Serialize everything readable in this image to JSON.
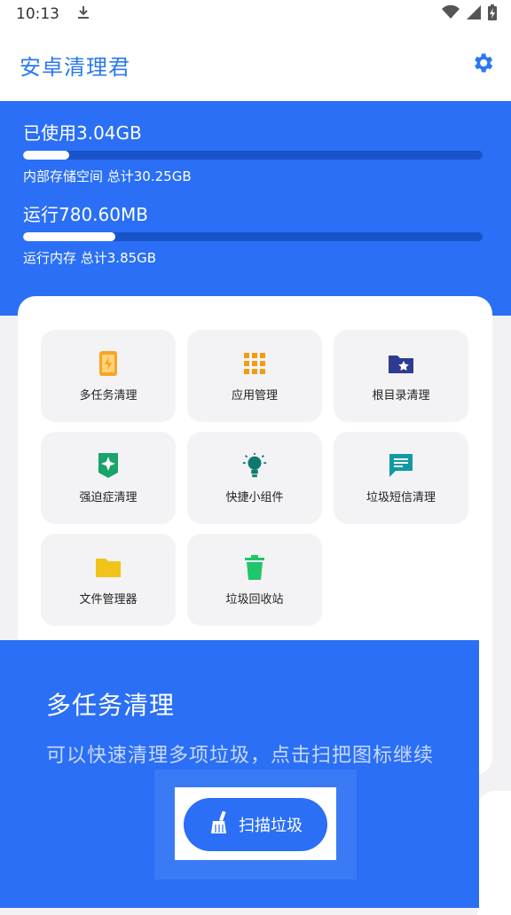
{
  "status_bar": {
    "time": "10:13",
    "download_icon": "download-icon",
    "wifi_icon": "wifi-icon",
    "signal_icon": "signal-icon",
    "battery_icon": "battery-charging-icon"
  },
  "app_bar": {
    "title": "安卓清理君",
    "settings_icon": "gear-icon"
  },
  "storage": {
    "used_label": "已使用3.04GB",
    "progress": 0.1,
    "subtitle": "内部存储空间 总计30.25GB"
  },
  "ram": {
    "used_label": "运行780.60MB",
    "progress": 0.2,
    "subtitle": "运行内存 总计3.85GB"
  },
  "tools": [
    {
      "label": "多任务清理",
      "icon": "phone-bolt-icon",
      "color": "#f5a623"
    },
    {
      "label": "应用管理",
      "icon": "apps-grid-icon",
      "color": "#f39c12"
    },
    {
      "label": "根目录清理",
      "icon": "folder-star-icon",
      "color": "#2e3c8f"
    },
    {
      "label": "强迫症清理",
      "icon": "sparkle-badge-icon",
      "color": "#1aa36b"
    },
    {
      "label": "快捷小组件",
      "icon": "lightbulb-icon",
      "color": "#0e7a6e"
    },
    {
      "label": "垃圾短信清理",
      "icon": "message-icon",
      "color": "#0f9aa3"
    },
    {
      "label": "文件管理器",
      "icon": "folder-icon",
      "color": "#f0c419"
    },
    {
      "label": "垃圾回收站",
      "icon": "trash-icon",
      "color": "#1fc76a"
    }
  ],
  "popup": {
    "title": "多任务清理",
    "description": "可以快速清理多项垃圾，点击扫把图标继续",
    "button_label": "扫描垃圾",
    "button_icon": "broom-icon"
  },
  "colors": {
    "primary": "#2a6ff5",
    "title": "#2a78f0"
  }
}
